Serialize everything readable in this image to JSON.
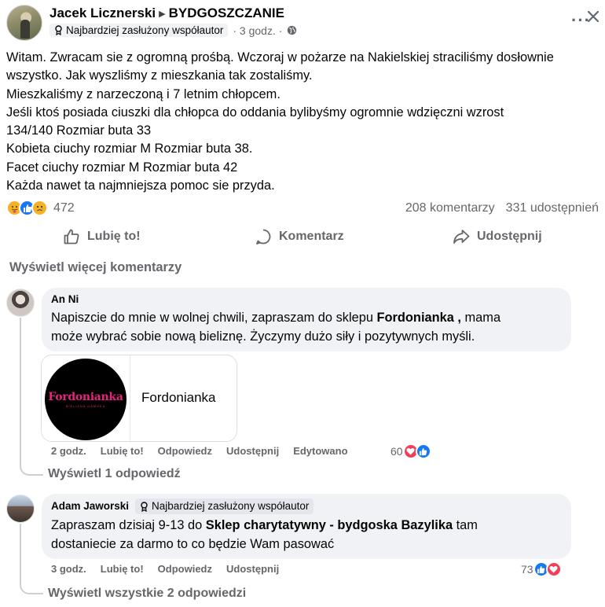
{
  "post": {
    "author": "Jacek Licznerski",
    "group": "BYDGOSZCZANIE",
    "badge": "Najbardziej zasłużony współautor",
    "time": "· 3 godz. ·",
    "text_lines": [
      "Witam. Zwracam sie z ogromną prośbą. Wczoraj w pożarze na Nakielskiej straciliśmy dosłownie",
      "wszystko. Jak wyszliśmy z mieszkania tak zostaliśmy.",
      "Mieszkaliśmy z narzeczoną i 7 letnim chłopcem.",
      "Jeśli ktoś  posiada ciuszki dla chłopca do oddania   bylibyśmy ogromnie wdzięczni wzrost",
      "134/140 Rozmiar buta 33",
      "Kobieta ciuchy rozmiar M  Rozmiar buta 38.",
      "Facet ciuchy rozmiar M Rozmiar buta 42",
      "Każda nawet ta najmniejsza pomoc sie przyda."
    ],
    "reaction_count": "472",
    "comments_count": "208 komentarzy",
    "shares_count": "331 udostępnień"
  },
  "actions": {
    "like": "Lubię to!",
    "comment": "Komentarz",
    "share": "Udostępnij"
  },
  "more_comments": "Wyświetl więcej komentarzy",
  "comments": [
    {
      "name": "An Ni",
      "text_before": "Napiszcie do mnie w wolnej chwili, zapraszam do sklepu ",
      "text_bold": "Fordonianka ,",
      "text_after": " mama",
      "text_line2": "może wybrać sobie nową bieliznę. Życzymy dużo siły i pozytywnych myśli.",
      "link_card": {
        "logo_text": "Fordonianka",
        "logo_subtext": "BIELIZNA DAMSKA",
        "title": "Fordonianka"
      },
      "time": "2 godz.",
      "like": "Lubię to!",
      "reply": "Odpowiedz",
      "share": "Udostępnij",
      "edited": "Edytowano",
      "reactions": "60",
      "view_replies": "Wyświetl 1 odpowiedź"
    },
    {
      "name": "Adam Jaworski",
      "badge": "Najbardziej zasłużony współautor",
      "text_before": "Zapraszam dzisiaj 9-13 do ",
      "text_bold": "Sklep charytatywny - bydgoska Bazylika",
      "text_after": " tam",
      "text_line2": "dostaniecie za darmo to co będzie Wam pasować",
      "time": "3 godz.",
      "like": "Lubię to!",
      "reply": "Odpowiedz",
      "share": "Udostępnij",
      "reactions": "73",
      "view_replies": "Wyświetl wszystkie 2 odpowiedzi"
    }
  ],
  "colors": {
    "facebook_blue": "#1877f2",
    "muted_text": "#65676b",
    "bubble_bg": "#f0f2f5",
    "heart_red": "#f33e58",
    "brand_pink": "#e6257e"
  }
}
